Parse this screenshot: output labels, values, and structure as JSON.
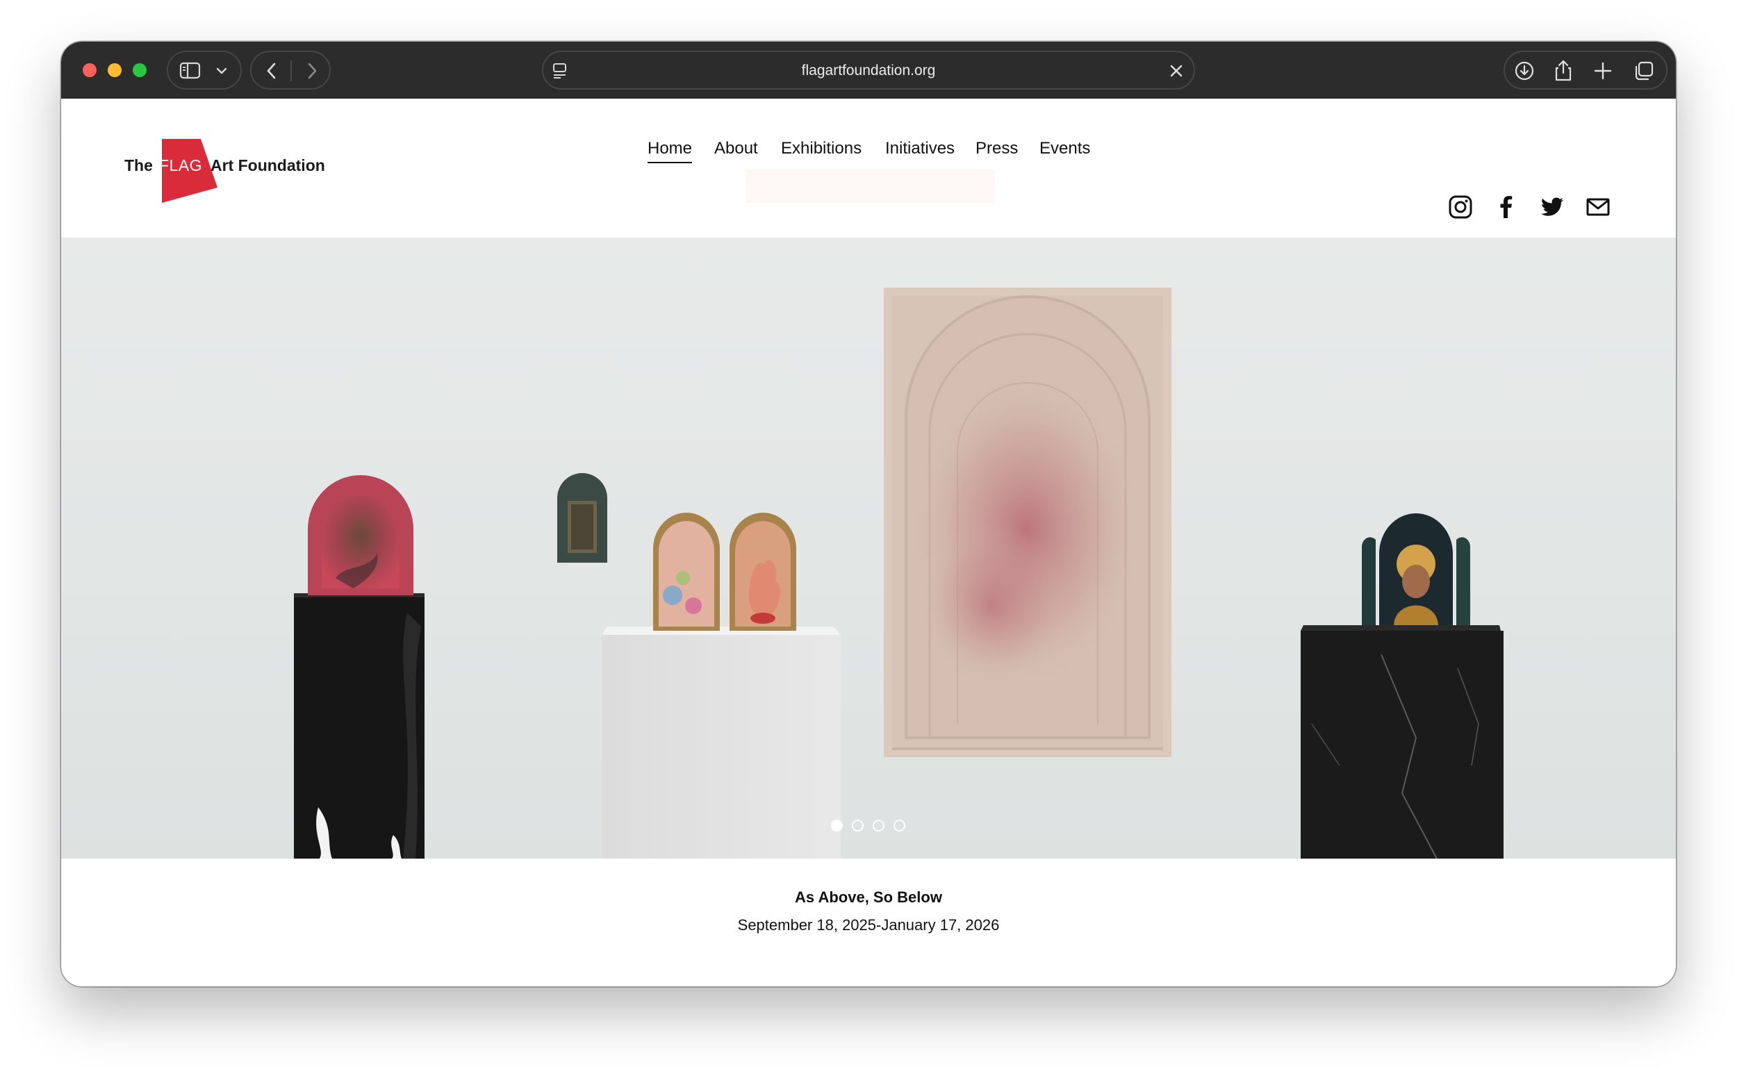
{
  "browser": {
    "url": "flagartfoundation.org",
    "icons": [
      "sidebar-icon",
      "chevron-down-icon",
      "back-icon",
      "forward-icon",
      "reader-icon",
      "clear-icon",
      "download-icon",
      "share-icon",
      "new-tab-icon",
      "tabs-overview-icon"
    ]
  },
  "logo": {
    "the": "The",
    "flag": "FLAG",
    "rest": "Art Foundation",
    "brand_color": "#d92b3a"
  },
  "nav": {
    "items": [
      {
        "label": "Home",
        "active": true
      },
      {
        "label": "About"
      },
      {
        "label": "Exhibitions"
      },
      {
        "label": "Initiatives"
      },
      {
        "label": "Press"
      },
      {
        "label": "Events"
      }
    ]
  },
  "social": {
    "icons": [
      "instagram-icon",
      "facebook-icon",
      "twitter-icon",
      "mail-icon"
    ]
  },
  "hero": {
    "slides_total": 4,
    "active_slide": 1
  },
  "caption": {
    "title": "As Above, So Below",
    "dates": "September 18, 2025-January 17, 2026"
  }
}
